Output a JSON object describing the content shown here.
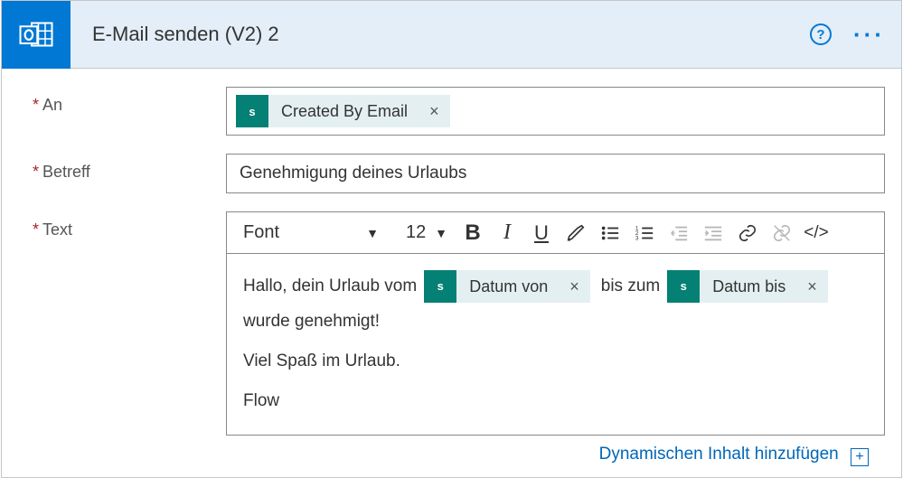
{
  "header": {
    "title": "E-Mail senden (V2) 2"
  },
  "labels": {
    "to": "An",
    "subject": "Betreff",
    "body": "Text"
  },
  "to_tokens": [
    {
      "label": "Created By Email"
    }
  ],
  "subject": "Genehmigung deines Urlaubs",
  "toolbar": {
    "font": "Font",
    "size": "12"
  },
  "body_content": {
    "seg1": "Hallo, dein Urlaub vom",
    "token1": "Datum von",
    "seg2": "bis zum",
    "token2": "Datum bis",
    "seg3": "wurde genehmigt!",
    "p2": "Viel Spaß im Urlaub.",
    "p3": "Flow"
  },
  "footer": {
    "add_dynamic": "Dynamischen Inhalt hinzufügen"
  }
}
